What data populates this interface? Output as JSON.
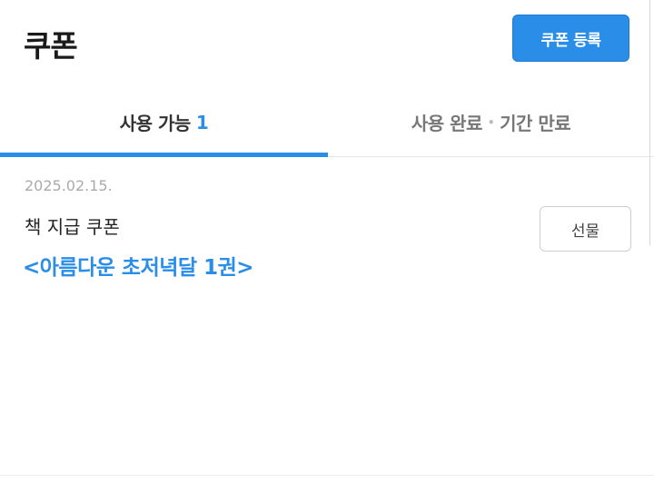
{
  "header": {
    "title": "쿠폰",
    "register_label": "쿠폰 등록"
  },
  "tabs": {
    "available": {
      "label": "사용 가능",
      "count": "1",
      "active": true
    },
    "done": {
      "label_used": "사용 완료",
      "separator": "•",
      "label_expired": "기간 만료",
      "active": false
    }
  },
  "coupons": [
    {
      "date": "2025.02.15.",
      "type": "책 지급 쿠폰",
      "book": "<아름다운 초저녁달 1권>",
      "gift_label": "선물"
    }
  ],
  "colors": {
    "accent": "#2a8ee8",
    "muted_text": "#aaaaaa",
    "border": "#cfcfcf"
  }
}
